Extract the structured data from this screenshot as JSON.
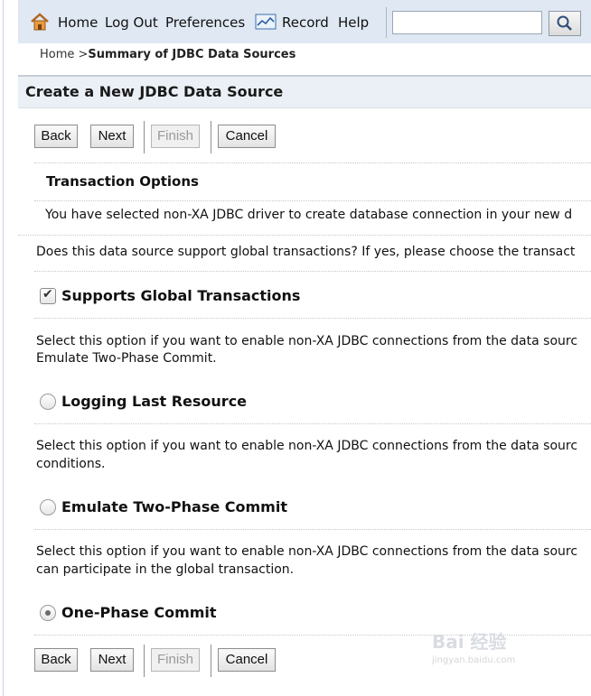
{
  "toolbar": {
    "home": "Home",
    "logout": "Log Out",
    "preferences": "Preferences",
    "record": "Record",
    "help": "Help",
    "search_value": ""
  },
  "breadcrumb": {
    "home": "Home >",
    "current": "Summary of JDBC Data Sources"
  },
  "panel": {
    "title": "Create a New JDBC Data Source"
  },
  "buttons": {
    "back": "Back",
    "next": "Next",
    "finish": "Finish",
    "cancel": "Cancel"
  },
  "section": {
    "title": "Transaction Options",
    "intro": "You have selected non-XA JDBC driver to create database connection in your new d",
    "question": "Does this data source support global transactions? If yes, please choose the transact"
  },
  "options": {
    "supports_global": "Supports Global Transactions",
    "supports_global_checked": true,
    "desc1_line1": "Select this option if you want to enable non-XA JDBC connections from the data sourc",
    "desc1_line2": "Emulate Two-Phase Commit.",
    "llr": "Logging Last Resource",
    "desc2_line1": "Select this option if you want to enable non-XA JDBC connections from the data sourc",
    "desc2_line2": "conditions.",
    "emulate": "Emulate Two-Phase Commit",
    "desc3_line1": "Select this option if you want to enable non-XA JDBC connections from the data sourc",
    "desc3_line2": "can participate in the global transaction.",
    "one_phase": "One-Phase Commit",
    "selected_protocol": "One-Phase Commit"
  },
  "watermark": {
    "main": "Bai 经验",
    "sub": "jingyan.baidu.com"
  },
  "icons": [
    "home-icon",
    "record-icon",
    "search-icon"
  ]
}
